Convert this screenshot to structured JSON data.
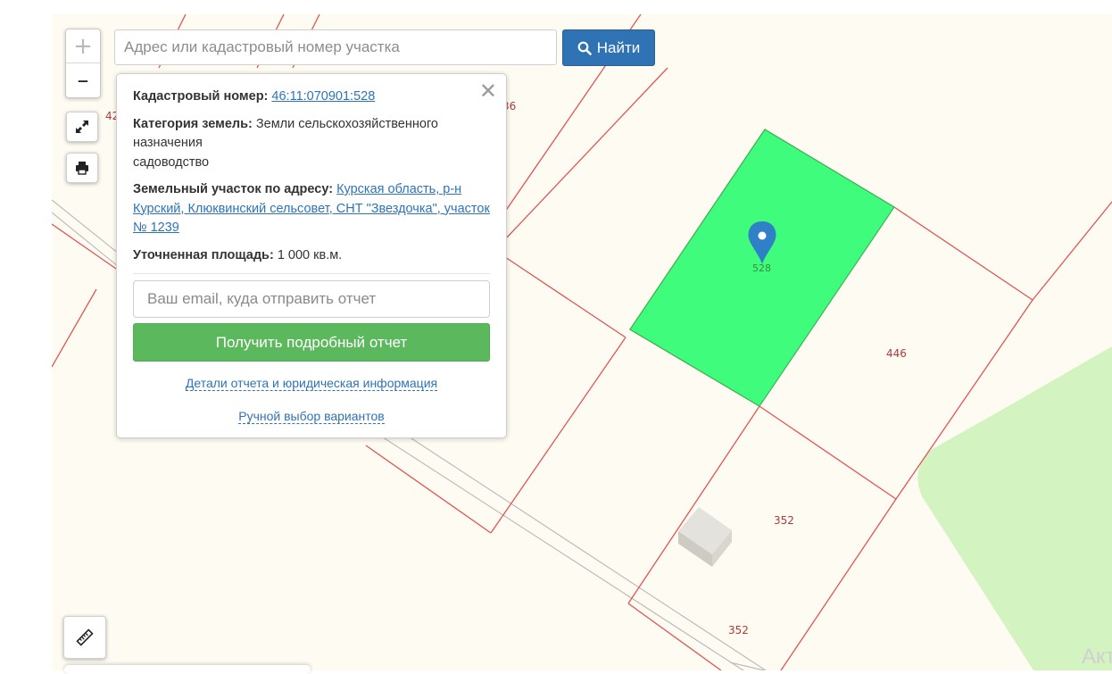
{
  "search": {
    "placeholder": "Адрес или кадастровый номер участка",
    "button_label": "Найти",
    "button_icon": "search-icon"
  },
  "zoom": {
    "in_label": "+",
    "out_label": "–"
  },
  "map": {
    "parcel_labels": {
      "selected": "528",
      "right": "446",
      "lower": "352",
      "bottom": "352",
      "partial_left": "42",
      "partial_top": "36"
    },
    "colors": {
      "background": "#fefcf2",
      "parcel_border": "#e05555",
      "selected_fill": "#3ffc7d",
      "green_area": "#d3f3c0",
      "marker": "#2f80c7"
    },
    "watermark": "Акт"
  },
  "popup": {
    "close_symbol": "✕",
    "cadastral": {
      "label": "Кадастровый номер:",
      "value": "46:11:070901:528"
    },
    "category": {
      "label": "Категория земель:",
      "value": "Земли сельскохозяйственного назначения",
      "use": "садоводство"
    },
    "address": {
      "label": "Земельный участок по адресу:",
      "value": "Курская область, р-н Курский, Клюквинский сельсовет, СНТ \"Звездочка\", участок № 1239"
    },
    "area": {
      "label": "Уточненная площадь:",
      "value": "1 000 кв.м."
    },
    "email_placeholder": "Ваш email, куда отправить отчет",
    "report_button": "Получить подробный отчет",
    "details_link": "Детали отчета и юридическая информация",
    "manual_link": "Ручной выбор вариантов"
  },
  "controls": {
    "fullscreen_icon": "fullscreen-icon",
    "print_icon": "print-icon",
    "ruler_icon": "ruler-icon"
  }
}
